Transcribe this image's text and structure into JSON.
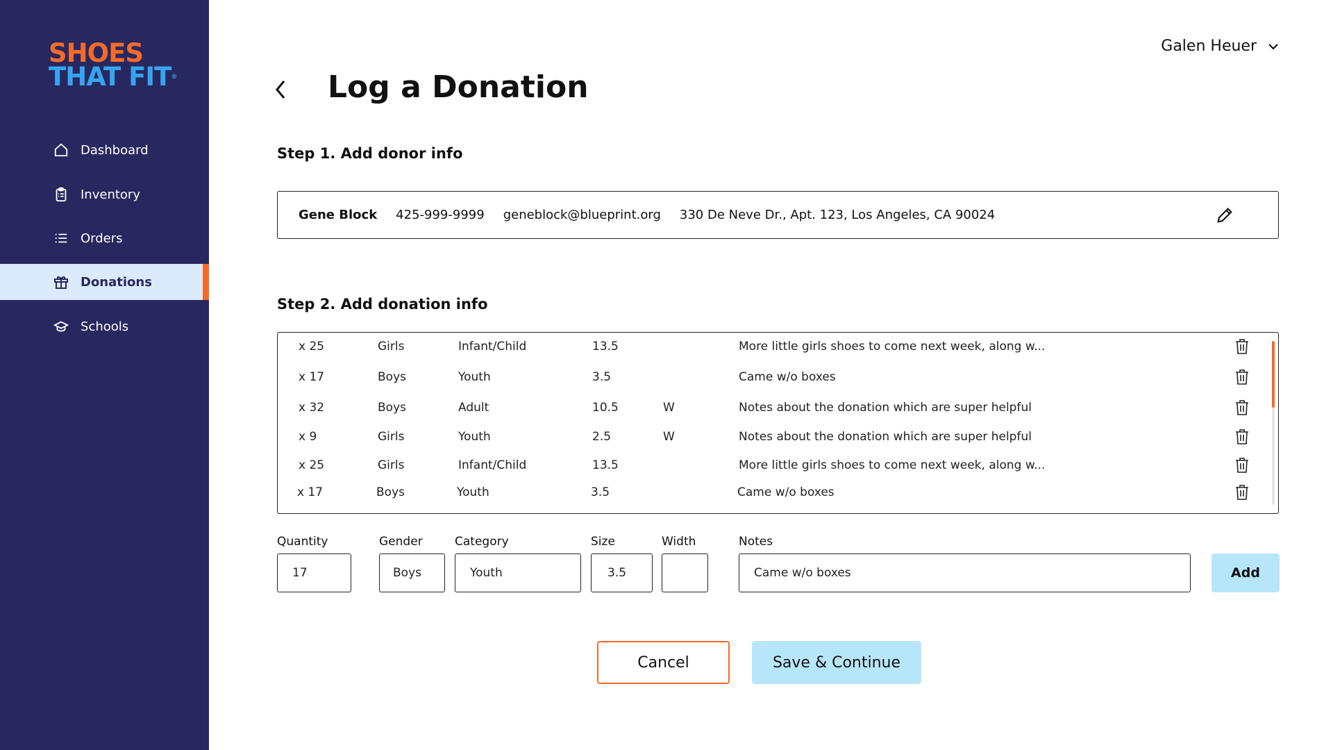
{
  "brand": {
    "line1": "SHOES",
    "line2": "THAT FIT",
    "reg": "®"
  },
  "sidebar": {
    "items": [
      {
        "label": "Dashboard",
        "icon": "home-icon"
      },
      {
        "label": "Inventory",
        "icon": "clipboard-icon"
      },
      {
        "label": "Orders",
        "icon": "list-icon"
      },
      {
        "label": "Donations",
        "icon": "gift-icon",
        "active": true
      },
      {
        "label": "Schools",
        "icon": "graduation-cap-icon"
      }
    ]
  },
  "header": {
    "user_name": "Galen Heuer",
    "title": "Log a Donation"
  },
  "step1": {
    "heading": "Step 1. Add donor info",
    "donor": {
      "name": "Gene Block",
      "phone": "425-999-9999",
      "email": "geneblock@blueprint.org",
      "address": "330 De Neve Dr., Apt. 123, Los Angeles, CA 90024"
    }
  },
  "step2": {
    "heading": "Step 2. Add donation info",
    "rows": [
      {
        "qty": "x 25",
        "gender": "Girls",
        "category": "Infant/Child",
        "size": "13.5",
        "width": "",
        "notes": "More little girls shoes to come next week, along w..."
      },
      {
        "qty": "x 17",
        "gender": "Boys",
        "category": "Youth",
        "size": "3.5",
        "width": "",
        "notes": "Came w/o boxes"
      },
      {
        "qty": "x 32",
        "gender": "Boys",
        "category": "Adult",
        "size": "10.5",
        "width": "W",
        "notes": "Notes about the donation which are super helpful"
      },
      {
        "qty": "x 9",
        "gender": "Girls",
        "category": "Youth",
        "size": "2.5",
        "width": "W",
        "notes": "Notes about the donation which are super helpful"
      },
      {
        "qty": "x 25",
        "gender": "Girls",
        "category": "Infant/Child",
        "size": "13.5",
        "width": "",
        "notes": "More little girls shoes to come next week, along w..."
      },
      {
        "qty": "x 17",
        "gender": "Boys",
        "category": "Youth",
        "size": "3.5",
        "width": "",
        "notes": "Came w/o boxes"
      }
    ]
  },
  "form": {
    "labels": {
      "quantity": "Quantity",
      "gender": "Gender",
      "category": "Category",
      "size": "Size",
      "width": "Width",
      "notes": "Notes"
    },
    "values": {
      "quantity": "17",
      "gender": "Boys",
      "category": "Youth",
      "size": "3.5",
      "width": "",
      "notes": "Came w/o boxes"
    },
    "add_label": "Add"
  },
  "actions": {
    "cancel_label": "Cancel",
    "save_label": "Save & Continue"
  },
  "colors": {
    "sidebar": "#27285f",
    "accent": "#f26b2a",
    "active_bg": "#dcebfb",
    "button_bg": "#b7e6fa",
    "logo_blue": "#36a4f0"
  }
}
